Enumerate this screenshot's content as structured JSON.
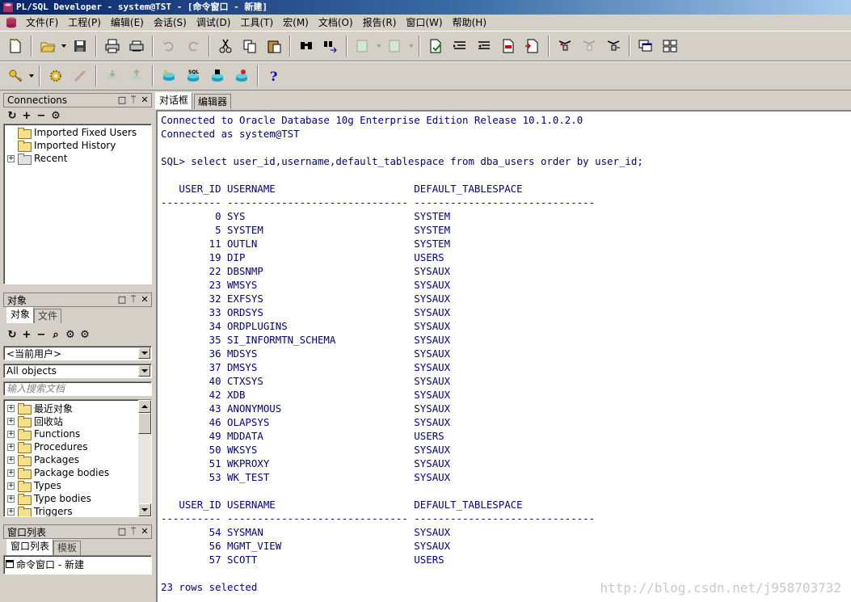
{
  "window": {
    "title": "PL/SQL Developer - system@TST - [命令窗口 - 新建]"
  },
  "menu": [
    "文件(F)",
    "工程(P)",
    "编辑(E)",
    "会话(S)",
    "调试(D)",
    "工具(T)",
    "宏(M)",
    "文档(O)",
    "报告(R)",
    "窗口(W)",
    "帮助(H)"
  ],
  "toolbar1": {
    "icons": [
      "new-icon",
      "open-icon",
      "save-icon",
      "print-icon",
      "print-preview-icon",
      "undo-icon",
      "redo-icon",
      "cut-icon",
      "copy-icon",
      "paste-icon",
      "find-icon",
      "find-next-icon",
      "indent-icon",
      "unindent-icon",
      "uppercase-icon",
      "lowercase-icon",
      "comment-icon",
      "uncomment-icon",
      "execute-plan-icon",
      "window-cascade-icon",
      "window-tile-icon"
    ]
  },
  "toolbar2": {
    "icons": [
      "key-icon",
      "gear-icon",
      "break-icon",
      "commit-icon",
      "rollback-icon",
      "db-connect-icon",
      "sql-icon",
      "db-refresh-icon",
      "db-run-icon",
      "help-icon"
    ]
  },
  "connections_panel": {
    "title": "Connections",
    "items": [
      {
        "label": "Imported Fixed Users"
      },
      {
        "label": "Imported History"
      },
      {
        "label": "Recent"
      }
    ]
  },
  "objects_panel": {
    "title": "对象",
    "tabs": [
      "对象",
      "文件"
    ],
    "owner_select": "<当前用户>",
    "filter_select": "All objects",
    "search_placeholder": "输入搜索文档",
    "items": [
      {
        "label": "最近对象"
      },
      {
        "label": "回收站"
      },
      {
        "label": "Functions"
      },
      {
        "label": "Procedures"
      },
      {
        "label": "Packages"
      },
      {
        "label": "Package bodies"
      },
      {
        "label": "Types"
      },
      {
        "label": "Type bodies"
      },
      {
        "label": "Triggers"
      }
    ]
  },
  "windows_panel": {
    "title": "窗口列表",
    "tabs": [
      "窗口列表",
      "模板"
    ],
    "items": [
      {
        "label": "命令窗口 - 新建"
      }
    ]
  },
  "main_tabs": [
    "对话框",
    "编辑器"
  ],
  "console": {
    "lines": [
      "Connected to Oracle Database 10g Enterprise Edition Release 10.1.0.2.0",
      "Connected as system@TST",
      "",
      "SQL> select user_id,username,default_tablespace from dba_users order by user_id;",
      "",
      "   USER_ID USERNAME                       DEFAULT_TABLESPACE",
      "---------- ------------------------------ ------------------------------",
      "         0 SYS                            SYSTEM",
      "         5 SYSTEM                         SYSTEM",
      "        11 OUTLN                          SYSTEM",
      "        19 DIP                            USERS",
      "        22 DBSNMP                         SYSAUX",
      "        23 WMSYS                          SYSAUX",
      "        32 EXFSYS                         SYSAUX",
      "        33 ORDSYS                         SYSAUX",
      "        34 ORDPLUGINS                     SYSAUX",
      "        35 SI_INFORMTN_SCHEMA             SYSAUX",
      "        36 MDSYS                          SYSAUX",
      "        37 DMSYS                          SYSAUX",
      "        40 CTXSYS                         SYSAUX",
      "        42 XDB                            SYSAUX",
      "        43 ANONYMOUS                      SYSAUX",
      "        46 OLAPSYS                        SYSAUX",
      "        49 MDDATA                         USERS",
      "        50 WKSYS                          SYSAUX",
      "        51 WKPROXY                        SYSAUX",
      "        53 WK_TEST                        SYSAUX",
      "",
      "   USER_ID USERNAME                       DEFAULT_TABLESPACE",
      "---------- ------------------------------ ------------------------------",
      "        54 SYSMAN                         SYSAUX",
      "        56 MGMT_VIEW                      SYSAUX",
      "        57 SCOTT                          USERS",
      "",
      "23 rows selected"
    ]
  },
  "watermark": "http://blog.csdn.net/j958703732"
}
